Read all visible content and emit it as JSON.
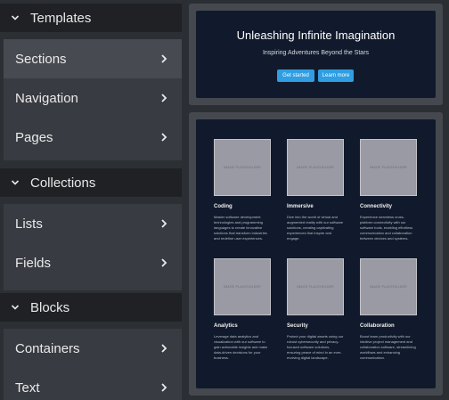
{
  "sidebar": {
    "groups": [
      {
        "title": "Templates",
        "items": [
          {
            "label": "Sections"
          },
          {
            "label": "Navigation"
          },
          {
            "label": "Pages"
          }
        ]
      },
      {
        "title": "Collections",
        "items": [
          {
            "label": "Lists"
          },
          {
            "label": "Fields"
          }
        ]
      },
      {
        "title": "Blocks",
        "items": [
          {
            "label": "Containers"
          },
          {
            "label": "Text"
          }
        ]
      }
    ]
  },
  "previews": {
    "hero": {
      "title": "Unleashing Infinite Imagination",
      "subtitle": "Inspiring Adventures Beyond the Stars",
      "primary_button": "Get started",
      "secondary_button": "Learn more"
    },
    "features": {
      "placeholder_text": "IMAGE PLACEHOLDER",
      "cards": [
        {
          "title": "Coding",
          "description": "Master software development technologies and programming languages to create innovative solutions that transform industries and redefine user experiences."
        },
        {
          "title": "Immersive",
          "description": "Dive into the world of virtual and augmented reality with our software solutions, creating captivating experiences that inspire and engage."
        },
        {
          "title": "Connectivity",
          "description": "Experience seamless cross-platform connectivity with our software tools, enabling effortless communication and collaboration between devices and systems."
        },
        {
          "title": "Analytics",
          "description": "Leverage data analytics and visualization with our software to gain actionable insights and make data-driven decisions for your business."
        },
        {
          "title": "Security",
          "description": "Protect your digital assets using our robust cybersecurity and privacy-focused software solutions, ensuring peace of mind in an ever-evolving digital landscape."
        },
        {
          "title": "Collaboration",
          "description": "Boost team productivity with our intuitive project management and collaboration software, streamlining workflows and enhancing communication."
        }
      ]
    }
  },
  "colors": {
    "accent": "#2f9ee3",
    "preview_bg": "#111a2c",
    "sidebar_header": "#1f2125"
  }
}
